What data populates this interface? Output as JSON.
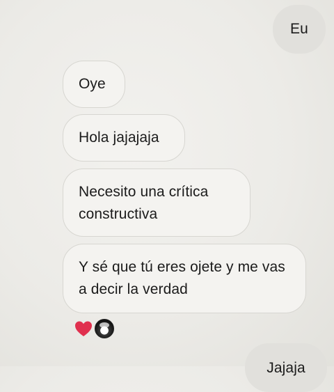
{
  "messages": [
    {
      "id": "eu",
      "direction": "sent",
      "text": "Eu"
    },
    {
      "id": "oye",
      "direction": "received",
      "text": "Oye"
    },
    {
      "id": "hola",
      "direction": "received",
      "text": "Hola jajajaja"
    },
    {
      "id": "necesito",
      "direction": "received",
      "text": "Necesito una crítica constructiva"
    },
    {
      "id": "y",
      "direction": "received",
      "text": "Y sé que tú eres ojete y me vas a decir la verdad"
    },
    {
      "id": "jaja",
      "direction": "sent",
      "text": "Jajaja"
    }
  ],
  "reactions": {
    "emoji": "heart-icon",
    "color": "#e0304e"
  }
}
